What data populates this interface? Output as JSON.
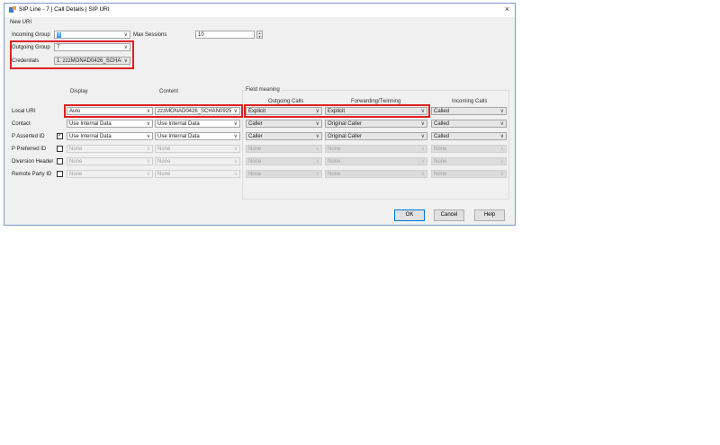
{
  "window": {
    "title": "SIP Line - 7 | Call Details | SIP URI",
    "close_label": "×"
  },
  "section_label": "New URI",
  "incoming_group": {
    "label": "Incoming Group",
    "value": "0"
  },
  "max_sessions": {
    "label": "Max Sessions",
    "value": "10"
  },
  "outgoing_group": {
    "label": "Outgoing Group",
    "value": "7"
  },
  "credentials": {
    "label": "Credentials",
    "value": "1: zzzMONAD0426_SCHAN"
  },
  "headers": {
    "display": "Display",
    "content": "Content",
    "field_meaning": "Field meaning",
    "outgoing_calls": "Outgoing Calls",
    "forwarding_twinning": "Forwarding/Twinning",
    "incoming_calls": "Incoming Calls"
  },
  "rows": [
    {
      "label": "Local URI",
      "display": "Auto",
      "content": "zzzMONAD0426_SCHAN0925",
      "outgoing": "Explicit",
      "forwarding": "Explicit",
      "incoming": "Called"
    },
    {
      "label": "Contact",
      "display": "Use Internal Data",
      "content": "Use Internal Data",
      "outgoing": "Caller",
      "forwarding": "Original Caller",
      "incoming": "Called"
    },
    {
      "label": "P Asserted ID",
      "display": "Use Internal Data",
      "content": "Use Internal Data",
      "outgoing": "Caller",
      "forwarding": "Original Caller",
      "incoming": "Called",
      "checked": true
    },
    {
      "label": "P Preferred  ID",
      "display": "None",
      "content": "None",
      "outgoing": "None",
      "forwarding": "None",
      "incoming": "None",
      "checked": false
    },
    {
      "label": "Diversion Header",
      "display": "None",
      "content": "None",
      "outgoing": "None",
      "forwarding": "None",
      "incoming": "None",
      "checked": false
    },
    {
      "label": "Remote Party ID",
      "display": "None",
      "content": "None",
      "outgoing": "None",
      "forwarding": "None",
      "incoming": "None",
      "checked": false
    }
  ],
  "buttons": {
    "ok": "OK",
    "cancel": "Cancel",
    "help": "Help"
  },
  "colors": {
    "highlight": "#e02020",
    "accent": "#0078d7",
    "selection": "#3399ff"
  },
  "icons": {
    "app": "phone-app-icon",
    "close": "close-icon",
    "dropdown": "chevron-down-icon",
    "spinner": "spinner-arrows-icon",
    "check": "checkmark-icon"
  }
}
